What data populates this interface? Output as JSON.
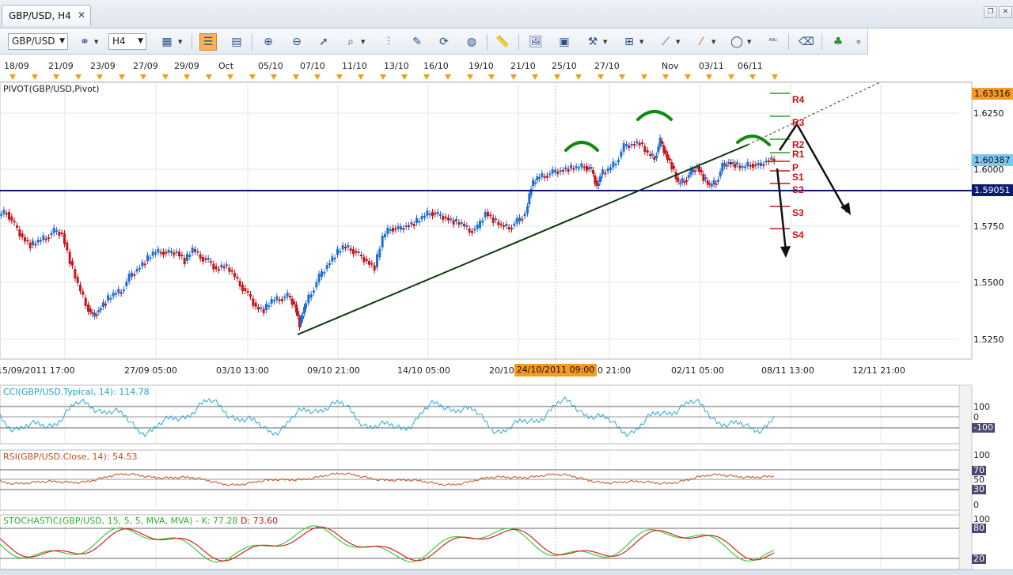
{
  "window": {
    "tab_title": "GBP/USD, H4",
    "close_glyph": "✕"
  },
  "toolbar": {
    "symbol": "GBP/USD",
    "timeframe": "H4",
    "icons": [
      "draw-mode-icon",
      "chart-type-icon",
      "properties-icon",
      "crosshair-icon",
      "hand-icon",
      "zoom-in-icon",
      "zoom-out-icon",
      "pointer-icon",
      "search-icon",
      "trendline-tool-icon",
      "pencil-tool-icon",
      "signal-icon",
      "globe-icon",
      "ruler-icon",
      "image-icon",
      "template-icon",
      "indicator-icon",
      "levels-icon",
      "draw-line-icon",
      "brush-icon",
      "ellipse-icon",
      "text-tool-icon",
      "eraser-icon",
      "hierarchy-icon",
      "more-icon"
    ]
  },
  "dates_top": [
    "18/09",
    "21/09",
    "23/09",
    "27/09",
    "29/09",
    "Oct",
    "05/10",
    "07/10",
    "11/10",
    "13/10",
    "16/10",
    "19/10",
    "21/10",
    "25/10",
    "27/10",
    "Nov",
    "03/11",
    "06/11"
  ],
  "main": {
    "indicator_label": "PIVOT(GBP/USD,Pivot)",
    "prices": [
      "1.6250",
      "1.6000",
      "1.5750",
      "1.5500",
      "1.5250"
    ],
    "badge_high": "1.63316",
    "badge_current": "1.60387",
    "badge_line": "1.59051",
    "pivots": [
      "R4",
      "R3",
      "R2",
      "R1",
      "P",
      "S1",
      "S2",
      "S3",
      "S4"
    ]
  },
  "time_axis": [
    "15/09/2011 17:00",
    "27/09 05:00",
    "03/10 13:00",
    "09/10 21:00",
    "14/10 05:00",
    "20/10",
    "0 21:00",
    "02/11 05:00",
    "08/11 13:00",
    "12/11 21:00"
  ],
  "cursor_date": "24/10/2011 09:00",
  "cci": {
    "label": "CCI(GBP/USD.Typical, 14): 114.78",
    "levels": [
      "100",
      "0",
      "-100"
    ]
  },
  "rsi": {
    "label": "RSI(GBP/USD.Close, 14): 54.53",
    "levels": [
      "100",
      "70",
      "50",
      "30",
      "0"
    ]
  },
  "stoch": {
    "label_main": "STOCHASTIC(GBP/USD, 15, 5, 5, MVA, MVA) -",
    "label_k": "K: 77.28",
    "label_d": "D: 73.60",
    "levels": [
      "100",
      "80",
      "20"
    ]
  },
  "colors": {
    "up": "#1f6fd6",
    "down": "#c4161c",
    "pivot_line": "#2f9e2f",
    "support_line": "#0a1a6e",
    "marker": "#f0a018"
  }
}
